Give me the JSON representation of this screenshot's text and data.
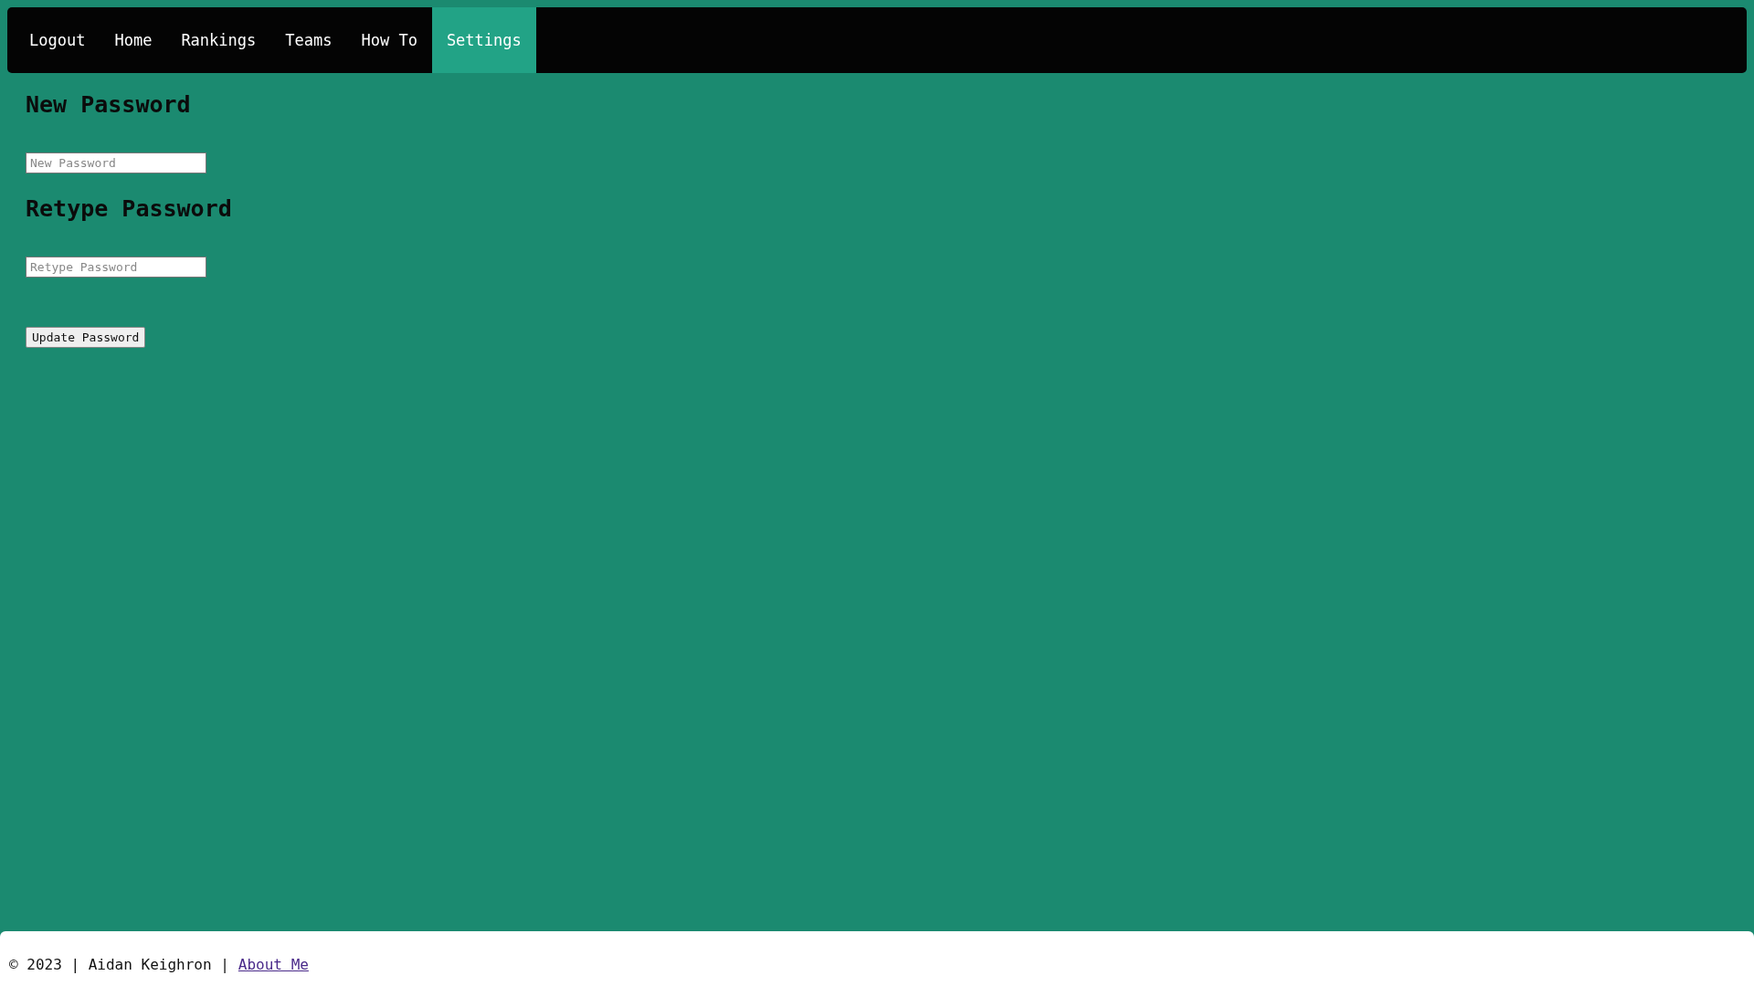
{
  "nav": {
    "items": [
      {
        "label": "Logout",
        "selected": false
      },
      {
        "label": "Home",
        "selected": false
      },
      {
        "label": "Rankings",
        "selected": false
      },
      {
        "label": "Teams",
        "selected": false
      },
      {
        "label": "How To",
        "selected": false
      },
      {
        "label": "Settings",
        "selected": true
      }
    ]
  },
  "form": {
    "fields": [
      {
        "heading": "New Password",
        "placeholder": "New Password"
      },
      {
        "heading": "Retype Password",
        "placeholder": "Retype Password"
      }
    ],
    "button": "Update Password"
  },
  "footer": {
    "text": "© 2023 | Aidan Keighron |",
    "link": "About Me"
  }
}
